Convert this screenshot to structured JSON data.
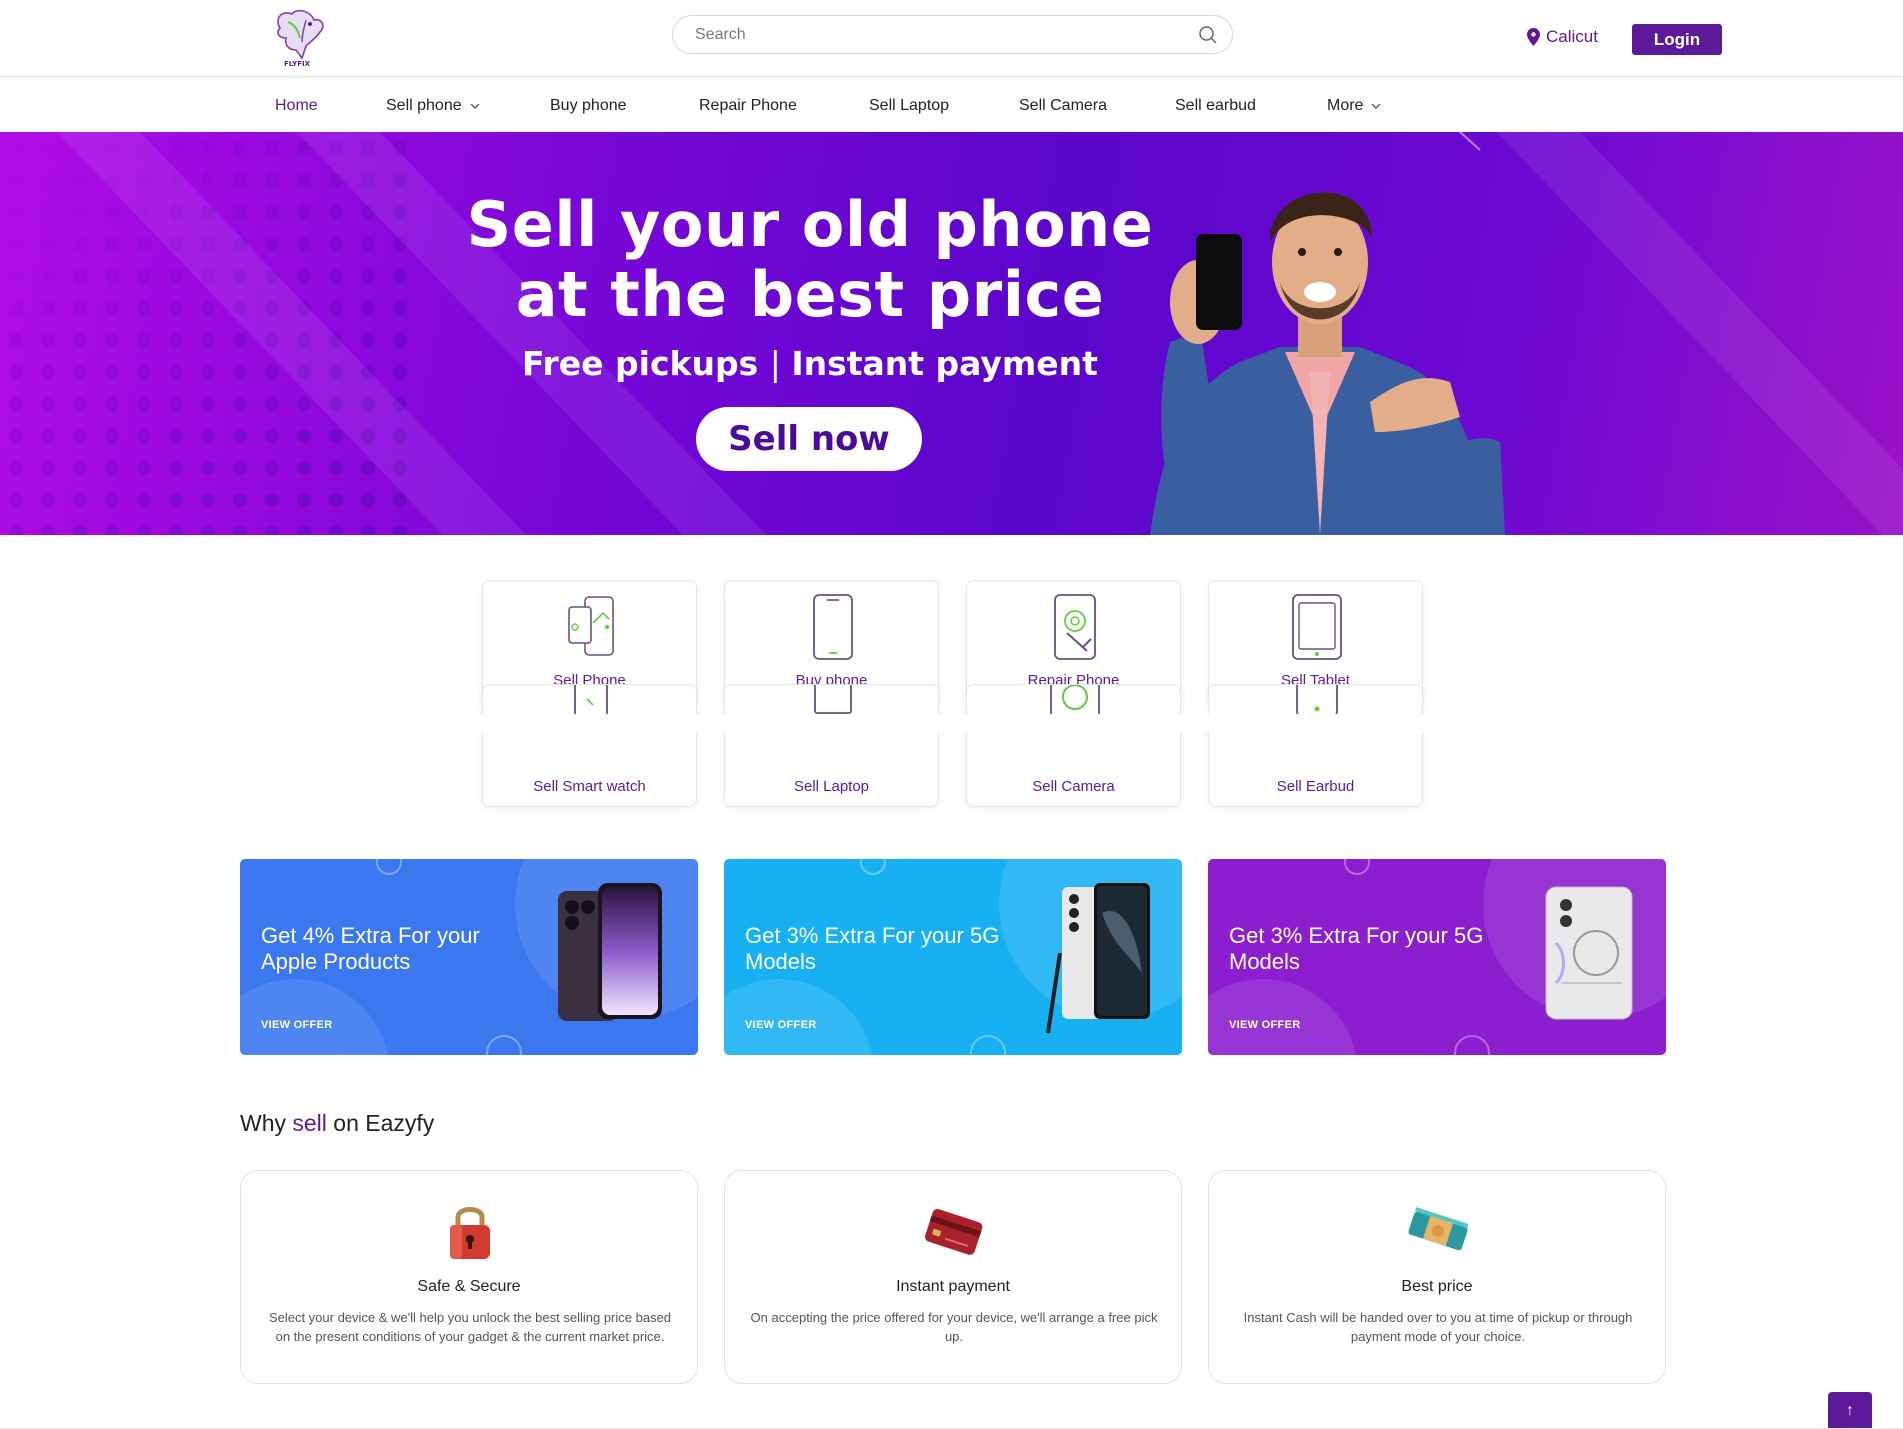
{
  "header": {
    "logo_text": "FLYFIX",
    "search_placeholder": "Search",
    "location": "Calicut",
    "login_label": "Login"
  },
  "nav": {
    "items": [
      {
        "label": "Home",
        "active": true
      },
      {
        "label": "Sell phone",
        "dropdown": true
      },
      {
        "label": "Buy phone"
      },
      {
        "label": "Repair Phone"
      },
      {
        "label": "Sell Laptop"
      },
      {
        "label": "Sell Camera"
      },
      {
        "label": "Sell earbud"
      },
      {
        "label": "More",
        "dropdown": true
      }
    ]
  },
  "hero": {
    "title_line1": "Sell your old phone",
    "title_line2": "at the best price",
    "subtitle_left": "Free pickups",
    "subtitle_right": "Instant payment",
    "cta_label": "Sell now"
  },
  "categories": [
    {
      "label": "Sell Phone",
      "icon": "sell-phone-icon"
    },
    {
      "label": "Buy phone",
      "icon": "buy-phone-icon"
    },
    {
      "label": "Repair Phone",
      "icon": "repair-phone-icon"
    },
    {
      "label": "Sell Tablet",
      "icon": "tablet-icon"
    },
    {
      "label": "Sell Smart watch",
      "icon": "smartwatch-icon"
    },
    {
      "label": "Sell Laptop",
      "icon": "laptop-icon"
    },
    {
      "label": "Sell Camera",
      "icon": "camera-icon"
    },
    {
      "label": "Sell Earbud",
      "icon": "earbud-icon"
    }
  ],
  "offers": [
    {
      "text": "Get 4% Extra For your Apple Products",
      "link": "VIEW OFFER",
      "color": "#3b78f0"
    },
    {
      "text": "Get 3% Extra For your 5G Models",
      "link": "VIEW OFFER",
      "color": "#16b0f3"
    },
    {
      "text": "Get 3% Extra For your 5G Models",
      "link": "VIEW OFFER",
      "color": "#8c1ed0"
    }
  ],
  "why": {
    "title_prefix": "Why",
    "title_highlight": "sell",
    "title_suffix": "on Eazyfy",
    "cards": [
      {
        "title": "Safe & Secure",
        "desc": "Select your device & we'll help you unlock the best selling price based on the present conditions of your gadget & the current market price.",
        "icon": "padlock-icon"
      },
      {
        "title": "Instant payment",
        "desc": "On accepting the price offered for your device, we'll arrange a free pick up.",
        "icon": "credit-card-icon"
      },
      {
        "title": "Best price",
        "desc": "Instant Cash will be handed over to you at time of pickup or through payment mode of your choice.",
        "icon": "cash-icon"
      }
    ]
  },
  "scroll_top_label": "↑"
}
